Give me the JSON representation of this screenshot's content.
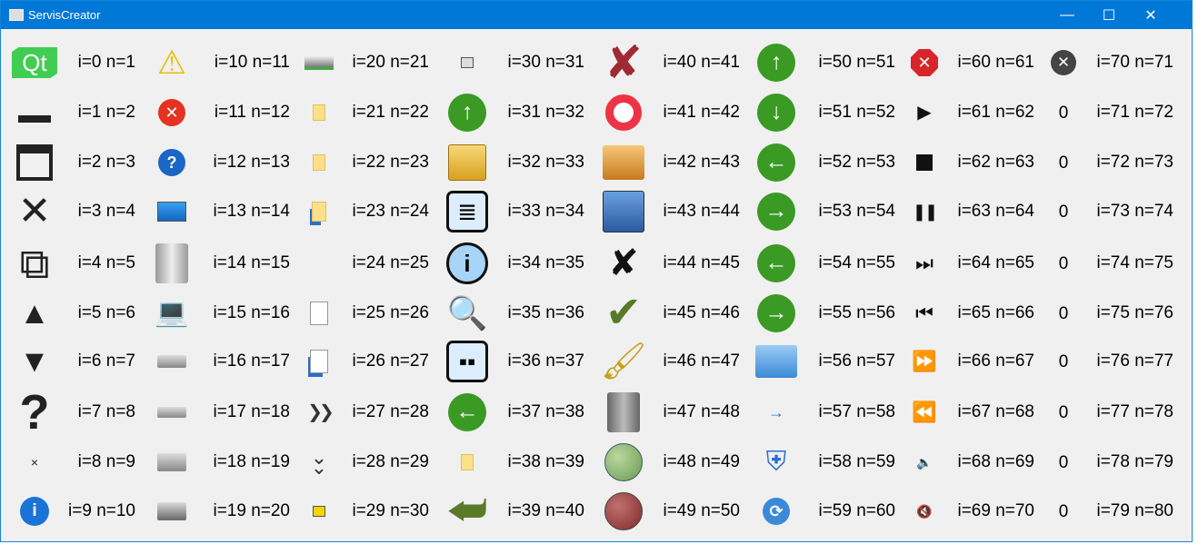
{
  "window": {
    "title": "ServisCreator",
    "minimize": "—",
    "maximize": "☐",
    "close": "✕"
  },
  "cells": [
    {
      "label": "i=0 n=1",
      "icon": "qt-logo-icon",
      "text": "Qt"
    },
    {
      "label": "i=1 n=2",
      "icon": "minimize-bar-icon"
    },
    {
      "label": "i=2 n=3",
      "icon": "maximize-window-icon"
    },
    {
      "label": "i=3 n=4",
      "icon": "close-x-icon"
    },
    {
      "label": "i=4 n=5",
      "icon": "restore-window-icon"
    },
    {
      "label": "i=5 n=6",
      "icon": "triangle-up-icon"
    },
    {
      "label": "i=6 n=7",
      "icon": "triangle-down-icon"
    },
    {
      "label": "i=7 n=8",
      "icon": "question-mark-icon"
    },
    {
      "label": "i=8 n=9",
      "icon": "small-x-icon"
    },
    {
      "label": "i=9 n=10",
      "icon": "info-circle-icon"
    },
    {
      "label": "i=10 n=11",
      "icon": "warning-icon"
    },
    {
      "label": "i=11 n=12",
      "icon": "error-circle-icon"
    },
    {
      "label": "i=12 n=13",
      "icon": "question-circle-icon"
    },
    {
      "label": "i=13 n=14",
      "icon": "desktop-icon"
    },
    {
      "label": "i=14 n=15",
      "icon": "trash-can-icon"
    },
    {
      "label": "i=15 n=16",
      "icon": "computer-icon"
    },
    {
      "label": "i=16 n=17",
      "icon": "floppy-drive-icon"
    },
    {
      "label": "i=17 n=18",
      "icon": "hard-drive-icon"
    },
    {
      "label": "i=18 n=19",
      "icon": "cd-drive-icon"
    },
    {
      "label": "i=19 n=20",
      "icon": "dvd-drive-icon"
    },
    {
      "label": "i=20 n=21",
      "icon": "network-drive-icon"
    },
    {
      "label": "i=21 n=22",
      "icon": "folder-small-icon"
    },
    {
      "label": "i=22 n=23",
      "icon": "folder-small-icon"
    },
    {
      "label": "i=23 n=24",
      "icon": "folder-link-icon"
    },
    {
      "label": "i=24 n=25",
      "icon": "empty-icon"
    },
    {
      "label": "i=25 n=26",
      "icon": "file-icon"
    },
    {
      "label": "i=26 n=27",
      "icon": "file-link-icon"
    },
    {
      "label": "i=27 n=28",
      "icon": "double-chevron-right-icon"
    },
    {
      "label": "i=28 n=29",
      "icon": "double-chevron-down-icon"
    },
    {
      "label": "i=29 n=30",
      "icon": "folder-open-small-icon"
    },
    {
      "label": "i=30 n=31",
      "icon": "small-drive-icon"
    },
    {
      "label": "i=31 n=32",
      "icon": "arrow-up-circle-icon"
    },
    {
      "label": "i=32 n=33",
      "icon": "new-folder-icon"
    },
    {
      "label": "i=33 n=34",
      "icon": "list-view-icon"
    },
    {
      "label": "i=34 n=35",
      "icon": "info-icon"
    },
    {
      "label": "i=35 n=36",
      "icon": "file-search-icon"
    },
    {
      "label": "i=36 n=37",
      "icon": "grid-view-icon"
    },
    {
      "label": "i=37 n=38",
      "icon": "arrow-left-circle-icon"
    },
    {
      "label": "i=38 n=39",
      "icon": "folder-small-icon"
    },
    {
      "label": "i=39 n=40",
      "icon": "return-arrow-icon"
    },
    {
      "label": "i=40 n=41",
      "icon": "red-x-icon"
    },
    {
      "label": "i=41 n=42",
      "icon": "lifebuoy-icon"
    },
    {
      "label": "i=42 n=43",
      "icon": "folder-open-icon"
    },
    {
      "label": "i=43 n=44",
      "icon": "save-floppy-icon"
    },
    {
      "label": "i=44 n=45",
      "icon": "black-x-icon"
    },
    {
      "label": "i=45 n=46",
      "icon": "checkmark-icon"
    },
    {
      "label": "i=46 n=47",
      "icon": "brush-icon"
    },
    {
      "label": "i=47 n=48",
      "icon": "trash-icon"
    },
    {
      "label": "i=48 n=49",
      "icon": "green-circle-icon"
    },
    {
      "label": "i=49 n=50",
      "icon": "red-circle-icon"
    },
    {
      "label": "i=50 n=51",
      "icon": "arrow-up-circle-icon"
    },
    {
      "label": "i=51 n=52",
      "icon": "arrow-down-circle-icon"
    },
    {
      "label": "i=52 n=53",
      "icon": "arrow-left-circle-icon"
    },
    {
      "label": "i=53 n=54",
      "icon": "arrow-right-circle-icon"
    },
    {
      "label": "i=54 n=55",
      "icon": "arrow-left-circle-icon"
    },
    {
      "label": "i=55 n=56",
      "icon": "arrow-right-circle-icon"
    },
    {
      "label": "i=56 n=57",
      "icon": "blue-folder-icon"
    },
    {
      "label": "i=57 n=58",
      "icon": "arrow-right-icon"
    },
    {
      "label": "i=58 n=59",
      "icon": "shield-icon"
    },
    {
      "label": "i=59 n=60",
      "icon": "refresh-icon"
    },
    {
      "label": "i=60 n=61",
      "icon": "stop-octagon-icon"
    },
    {
      "label": "i=61 n=62",
      "icon": "play-icon"
    },
    {
      "label": "i=62 n=63",
      "icon": "stop-icon"
    },
    {
      "label": "i=63 n=64",
      "icon": "pause-icon"
    },
    {
      "label": "i=64 n=65",
      "icon": "skip-forward-icon"
    },
    {
      "label": "i=65 n=66",
      "icon": "skip-backward-icon"
    },
    {
      "label": "i=66 n=67",
      "icon": "fast-forward-icon"
    },
    {
      "label": "i=67 n=68",
      "icon": "rewind-icon"
    },
    {
      "label": "i=68 n=69",
      "icon": "volume-icon"
    },
    {
      "label": "i=69 n=70",
      "icon": "volume-muted-icon"
    },
    {
      "label": "i=70 n=71",
      "icon": "close-circle-icon"
    },
    {
      "label": "i=71 n=72",
      "icon": "zero-text",
      "text": "0"
    },
    {
      "label": "i=72 n=73",
      "icon": "zero-text",
      "text": "0"
    },
    {
      "label": "i=73 n=74",
      "icon": "zero-text",
      "text": "0"
    },
    {
      "label": "i=74 n=75",
      "icon": "zero-text",
      "text": "0"
    },
    {
      "label": "i=75 n=76",
      "icon": "zero-text",
      "text": "0"
    },
    {
      "label": "i=76 n=77",
      "icon": "zero-text",
      "text": "0"
    },
    {
      "label": "i=77 n=78",
      "icon": "zero-text",
      "text": "0"
    },
    {
      "label": "i=78 n=79",
      "icon": "zero-text",
      "text": "0"
    },
    {
      "label": "i=79 n=80",
      "icon": "zero-text",
      "text": "0"
    }
  ]
}
